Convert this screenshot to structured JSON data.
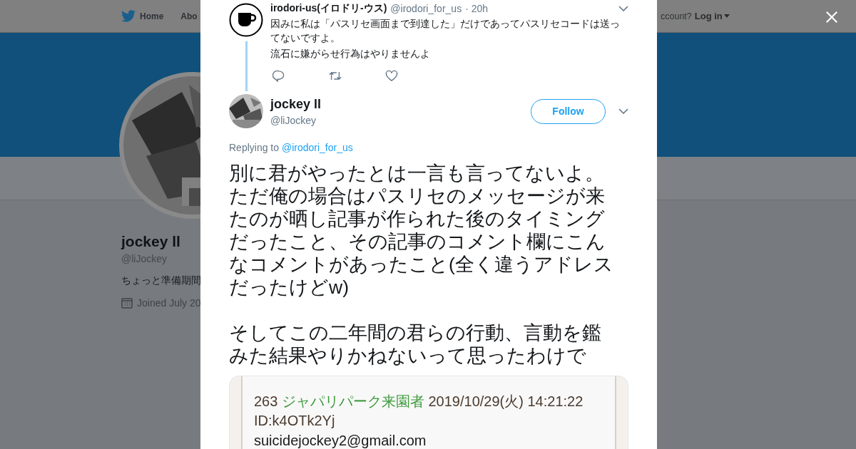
{
  "nav": {
    "home": "Home",
    "about": "Abo",
    "account_prompt": "ccount?",
    "login": "Log in"
  },
  "profile": {
    "name": "jockey ll",
    "handle": "@liJockey",
    "bio": "ちょっと準備期間",
    "joined": "Joined July 20"
  },
  "parent_tweet": {
    "name": "irodori-us(イロドリ-ウス)",
    "handle": "@irodori_for_us",
    "time": "· 20h",
    "lines": [
      "因みに私は「パスリセ画面まで到達した」だけであってパスリセコードは送ってないですよ。",
      "流石に嫌がらせ行為はやりませんよ"
    ]
  },
  "tweet": {
    "name": "jockey ll",
    "handle": "@liJockey",
    "follow": "Follow",
    "replying_label": "Replying to",
    "replying_handle": "@irodori_for_us",
    "paragraphs": [
      "別に君がやったとは一言も言ってないよ。ただ俺の場合はパスリセのメッセージが来たのが晒し記事が作られた後のタイミングだったこと、その記事のコメント欄にこんなコメントがあったこと(全く違うアドレスだったけどw)",
      "そしてこの二年間の君らの行動、言動を鑑みた結果やりかねないって思ったわけで"
    ],
    "attachment": {
      "post_number": "263",
      "poster": "ジャパリパーク来園者",
      "date": "2019/10/29(火) 14:21:22",
      "post_id": "ID:k4OTk2Yj",
      "body": "suicidejockey2@gmail.com"
    }
  }
}
